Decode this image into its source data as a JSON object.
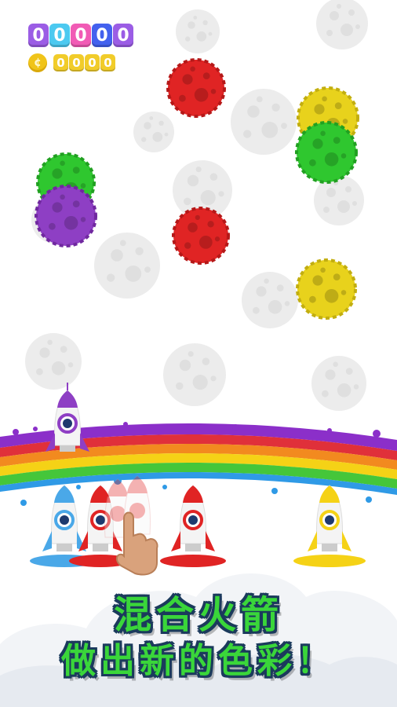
{
  "hud": {
    "score_digits": [
      "0",
      "0",
      "0",
      "0",
      "0"
    ],
    "coin_digits": [
      "0",
      "0",
      "0",
      "0"
    ],
    "coin_icon": "coin-icon",
    "score_colors": [
      "#9b5de5",
      "#4cc9f0",
      "#f15bb5",
      "#4361ee",
      "#9b5de5"
    ]
  },
  "slogan": {
    "line1": "混合火箭",
    "line2": "做出新的色彩！"
  },
  "meteors": {
    "active": [
      {
        "color": "red"
      },
      {
        "color": "yellow"
      },
      {
        "color": "green"
      },
      {
        "color": "green"
      },
      {
        "color": "purple"
      },
      {
        "color": "red"
      },
      {
        "color": "yellow"
      }
    ]
  },
  "rockets": {
    "top": {
      "color": "purple"
    },
    "bottom": [
      {
        "color": "blue"
      },
      {
        "color": "red"
      },
      {
        "color": "red"
      },
      {
        "color": "yellow"
      }
    ]
  },
  "colors": {
    "red": "#e02424",
    "yellow": "#e8d21c",
    "green": "#2fc72f",
    "purple": "#8e3fc4",
    "blue": "#4aa8e8",
    "ghost": "#ececec",
    "rainbow": [
      "#8b2fc9",
      "#e0303a",
      "#f28a1f",
      "#f5d216",
      "#45c63a",
      "#2f9ae6"
    ]
  }
}
